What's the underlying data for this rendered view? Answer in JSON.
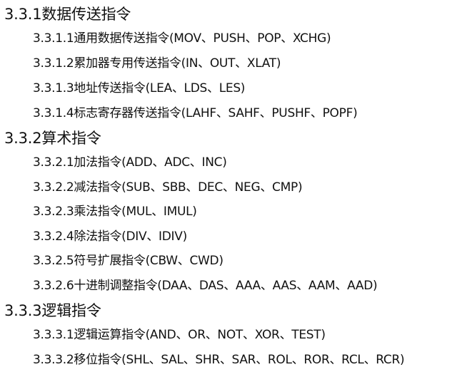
{
  "sections": [
    {
      "title": "3.3.1数据传送指令",
      "items": [
        "3.3.1.1通用数据传送指令(MOV、PUSH、POP、XCHG)",
        "3.3.1.2累加器专用传送指令(IN、OUT、XLAT)",
        "3.3.1.3地址传送指令(LEA、LDS、LES)",
        "3.3.1.4标志寄存器传送指令(LAHF、SAHF、PUSHF、POPF)"
      ]
    },
    {
      "title": "3.3.2算术指令",
      "items": [
        "3.3.2.1加法指令(ADD、ADC、INC)",
        "3.3.2.2减法指令(SUB、SBB、DEC、NEG、CMP)",
        "3.3.2.3乘法指令(MUL、IMUL)",
        "3.3.2.4除法指令(DIV、IDIV)",
        "3.3.2.5符号扩展指令(CBW、CWD)",
        "3.3.2.6十进制调整指令(DAA、DAS、AAA、AAS、AAM、AAD)"
      ]
    },
    {
      "title": "3.3.3逻辑指令",
      "items": [
        "3.3.3.1逻辑运算指令(AND、OR、NOT、XOR、TEST)",
        "3.3.3.2移位指令(SHL、SAL、SHR、SAR、ROL、ROR、RCL、RCR)"
      ]
    }
  ]
}
